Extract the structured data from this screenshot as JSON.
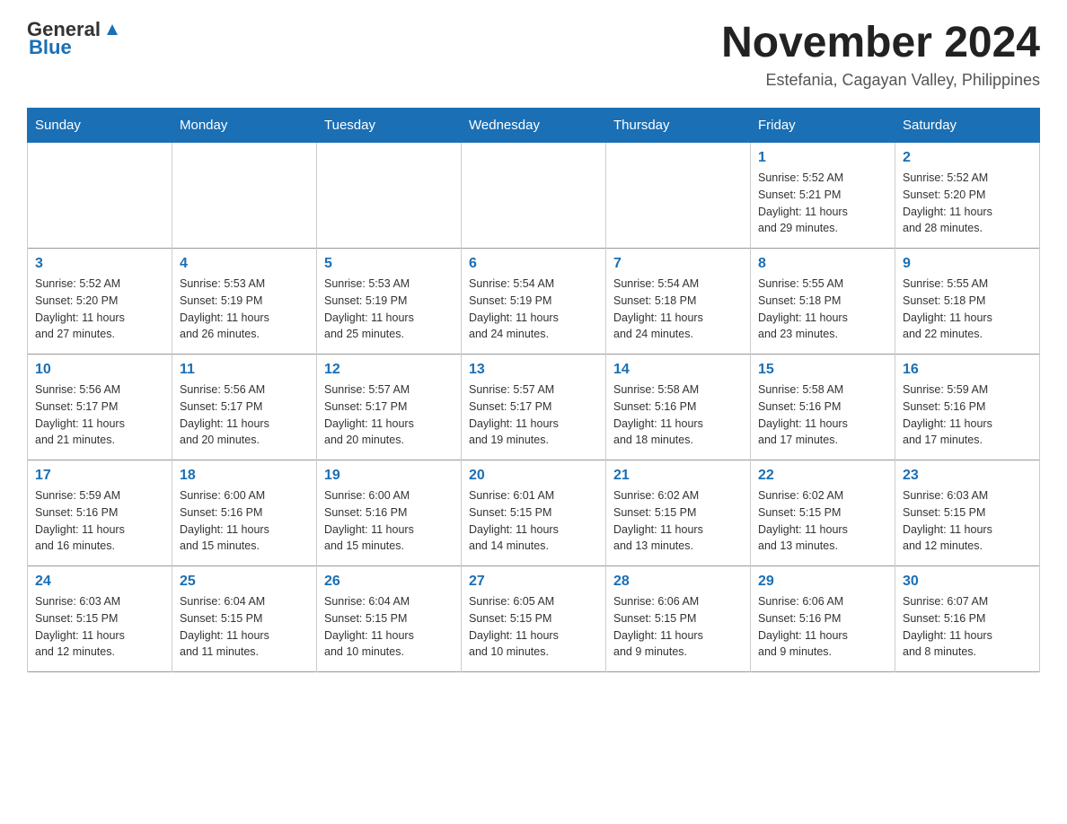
{
  "header": {
    "logo_general": "General",
    "logo_blue": "Blue",
    "month_year": "November 2024",
    "subtitle": "Estefania, Cagayan Valley, Philippines"
  },
  "weekdays": [
    "Sunday",
    "Monday",
    "Tuesday",
    "Wednesday",
    "Thursday",
    "Friday",
    "Saturday"
  ],
  "weeks": [
    [
      {
        "day": "",
        "info": ""
      },
      {
        "day": "",
        "info": ""
      },
      {
        "day": "",
        "info": ""
      },
      {
        "day": "",
        "info": ""
      },
      {
        "day": "",
        "info": ""
      },
      {
        "day": "1",
        "info": "Sunrise: 5:52 AM\nSunset: 5:21 PM\nDaylight: 11 hours\nand 29 minutes."
      },
      {
        "day": "2",
        "info": "Sunrise: 5:52 AM\nSunset: 5:20 PM\nDaylight: 11 hours\nand 28 minutes."
      }
    ],
    [
      {
        "day": "3",
        "info": "Sunrise: 5:52 AM\nSunset: 5:20 PM\nDaylight: 11 hours\nand 27 minutes."
      },
      {
        "day": "4",
        "info": "Sunrise: 5:53 AM\nSunset: 5:19 PM\nDaylight: 11 hours\nand 26 minutes."
      },
      {
        "day": "5",
        "info": "Sunrise: 5:53 AM\nSunset: 5:19 PM\nDaylight: 11 hours\nand 25 minutes."
      },
      {
        "day": "6",
        "info": "Sunrise: 5:54 AM\nSunset: 5:19 PM\nDaylight: 11 hours\nand 24 minutes."
      },
      {
        "day": "7",
        "info": "Sunrise: 5:54 AM\nSunset: 5:18 PM\nDaylight: 11 hours\nand 24 minutes."
      },
      {
        "day": "8",
        "info": "Sunrise: 5:55 AM\nSunset: 5:18 PM\nDaylight: 11 hours\nand 23 minutes."
      },
      {
        "day": "9",
        "info": "Sunrise: 5:55 AM\nSunset: 5:18 PM\nDaylight: 11 hours\nand 22 minutes."
      }
    ],
    [
      {
        "day": "10",
        "info": "Sunrise: 5:56 AM\nSunset: 5:17 PM\nDaylight: 11 hours\nand 21 minutes."
      },
      {
        "day": "11",
        "info": "Sunrise: 5:56 AM\nSunset: 5:17 PM\nDaylight: 11 hours\nand 20 minutes."
      },
      {
        "day": "12",
        "info": "Sunrise: 5:57 AM\nSunset: 5:17 PM\nDaylight: 11 hours\nand 20 minutes."
      },
      {
        "day": "13",
        "info": "Sunrise: 5:57 AM\nSunset: 5:17 PM\nDaylight: 11 hours\nand 19 minutes."
      },
      {
        "day": "14",
        "info": "Sunrise: 5:58 AM\nSunset: 5:16 PM\nDaylight: 11 hours\nand 18 minutes."
      },
      {
        "day": "15",
        "info": "Sunrise: 5:58 AM\nSunset: 5:16 PM\nDaylight: 11 hours\nand 17 minutes."
      },
      {
        "day": "16",
        "info": "Sunrise: 5:59 AM\nSunset: 5:16 PM\nDaylight: 11 hours\nand 17 minutes."
      }
    ],
    [
      {
        "day": "17",
        "info": "Sunrise: 5:59 AM\nSunset: 5:16 PM\nDaylight: 11 hours\nand 16 minutes."
      },
      {
        "day": "18",
        "info": "Sunrise: 6:00 AM\nSunset: 5:16 PM\nDaylight: 11 hours\nand 15 minutes."
      },
      {
        "day": "19",
        "info": "Sunrise: 6:00 AM\nSunset: 5:16 PM\nDaylight: 11 hours\nand 15 minutes."
      },
      {
        "day": "20",
        "info": "Sunrise: 6:01 AM\nSunset: 5:15 PM\nDaylight: 11 hours\nand 14 minutes."
      },
      {
        "day": "21",
        "info": "Sunrise: 6:02 AM\nSunset: 5:15 PM\nDaylight: 11 hours\nand 13 minutes."
      },
      {
        "day": "22",
        "info": "Sunrise: 6:02 AM\nSunset: 5:15 PM\nDaylight: 11 hours\nand 13 minutes."
      },
      {
        "day": "23",
        "info": "Sunrise: 6:03 AM\nSunset: 5:15 PM\nDaylight: 11 hours\nand 12 minutes."
      }
    ],
    [
      {
        "day": "24",
        "info": "Sunrise: 6:03 AM\nSunset: 5:15 PM\nDaylight: 11 hours\nand 12 minutes."
      },
      {
        "day": "25",
        "info": "Sunrise: 6:04 AM\nSunset: 5:15 PM\nDaylight: 11 hours\nand 11 minutes."
      },
      {
        "day": "26",
        "info": "Sunrise: 6:04 AM\nSunset: 5:15 PM\nDaylight: 11 hours\nand 10 minutes."
      },
      {
        "day": "27",
        "info": "Sunrise: 6:05 AM\nSunset: 5:15 PM\nDaylight: 11 hours\nand 10 minutes."
      },
      {
        "day": "28",
        "info": "Sunrise: 6:06 AM\nSunset: 5:15 PM\nDaylight: 11 hours\nand 9 minutes."
      },
      {
        "day": "29",
        "info": "Sunrise: 6:06 AM\nSunset: 5:16 PM\nDaylight: 11 hours\nand 9 minutes."
      },
      {
        "day": "30",
        "info": "Sunrise: 6:07 AM\nSunset: 5:16 PM\nDaylight: 11 hours\nand 8 minutes."
      }
    ]
  ]
}
